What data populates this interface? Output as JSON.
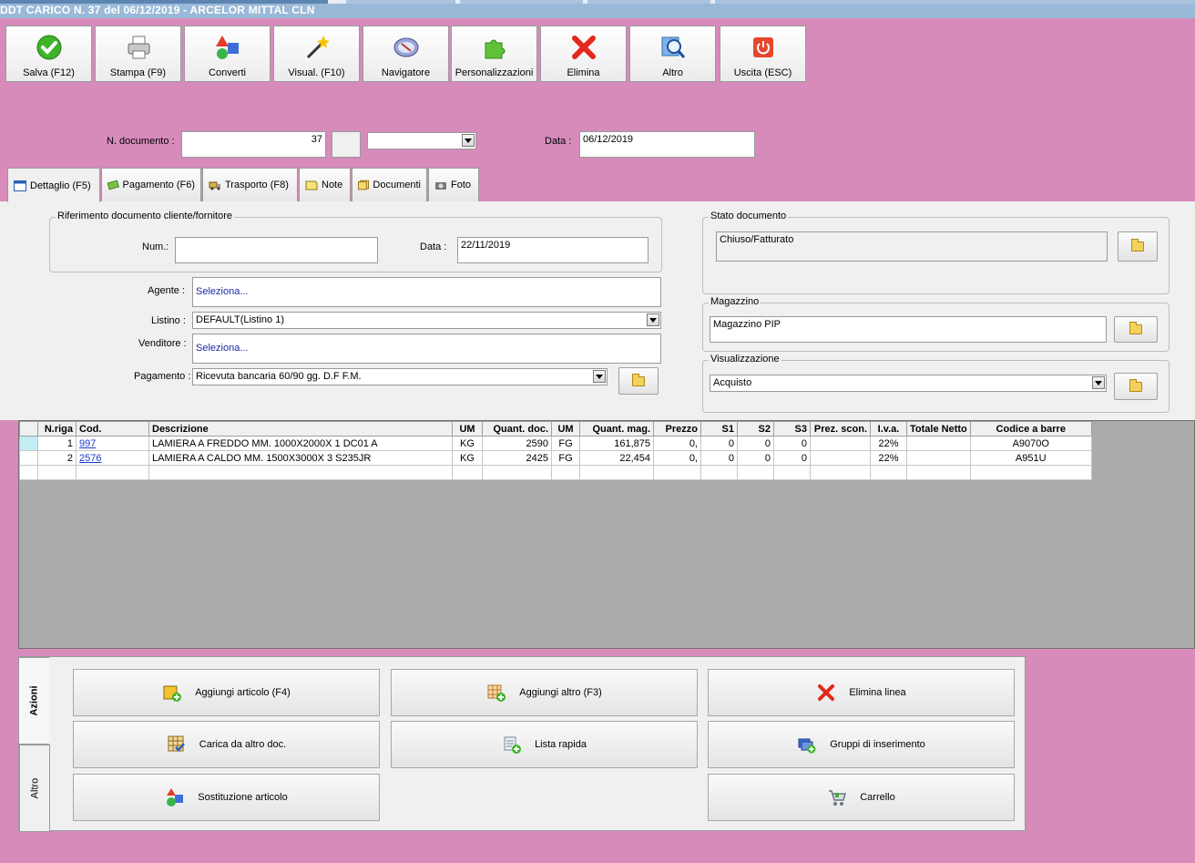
{
  "window": {
    "title": "DDT CARICO N. 37 del 06/12/2019 - ARCELOR MITTAL CLN"
  },
  "toolbar": [
    {
      "key": "salva",
      "label": "Salva (F12)",
      "icon": "checkmark-icon"
    },
    {
      "key": "stampa",
      "label": "Stampa (F9)",
      "icon": "printer-icon"
    },
    {
      "key": "converti",
      "label": "Converti",
      "icon": "convert-shapes-icon"
    },
    {
      "key": "visual",
      "label": "Visual. (F10)",
      "icon": "magic-wand-icon"
    },
    {
      "key": "navigatore",
      "label": "Navigatore",
      "icon": "compass-icon"
    },
    {
      "key": "personalizzazioni",
      "label": "Personalizzazioni",
      "icon": "puzzle-icon"
    },
    {
      "key": "elimina",
      "label": "Elimina",
      "icon": "red-x-icon"
    },
    {
      "key": "altro",
      "label": "Altro",
      "icon": "magnifier-icon"
    },
    {
      "key": "uscita",
      "label": "Uscita (ESC)",
      "icon": "power-icon"
    }
  ],
  "header": {
    "ndoc_label": "N. documento :",
    "ndoc_value": "37",
    "series_value": "",
    "data_label": "Data :",
    "data_value": "06/12/2019"
  },
  "tabs": [
    {
      "label": "Dettaglio (F5)",
      "icon": "calendar-icon",
      "active": true
    },
    {
      "label": "Pagamento (F6)",
      "icon": "money-icon"
    },
    {
      "label": "Trasporto (F8)",
      "icon": "truck-icon"
    },
    {
      "label": "Note",
      "icon": "note-icon"
    },
    {
      "label": "Documenti",
      "icon": "documents-icon"
    },
    {
      "label": "Foto",
      "icon": "camera-icon"
    }
  ],
  "riferimento": {
    "title": "Riferimento documento cliente/fornitore",
    "num_label": "Num.:",
    "num_value": "",
    "data_label": "Data :",
    "data_value": "22/11/2019"
  },
  "agente": {
    "label": "Agente :",
    "value": "Seleziona..."
  },
  "listino": {
    "label": "Listino :",
    "value": "DEFAULT(Listino 1)"
  },
  "venditore": {
    "label": "Venditore :",
    "value": "Seleziona..."
  },
  "pagamento": {
    "label": "Pagamento :",
    "value": "Ricevuta bancaria 60/90 gg. D.F F.M."
  },
  "stato": {
    "title": "Stato documento",
    "value": "Chiuso/Fatturato"
  },
  "magazzino": {
    "title": "Magazzino",
    "value": "Magazzino PIP"
  },
  "visualizzazione": {
    "title": "Visualizzazione",
    "value": "Acquisto"
  },
  "grid": {
    "columns": [
      "N.riga",
      "Cod.",
      "Descrizione",
      "UM",
      "Quant. doc.",
      "UM",
      "Quant. mag.",
      "Prezzo",
      "S1",
      "S2",
      "S3",
      "Prez. scon.",
      "I.v.a.",
      "Totale Netto",
      "Codice a barre"
    ],
    "rows": [
      [
        "1",
        "997",
        "LAMIERA A FREDDO MM. 1000X2000X 1  DC01 A",
        "KG",
        "2590",
        "FG",
        "161,875",
        "0,",
        "0",
        "0",
        "0",
        "",
        "22%",
        "",
        "A9070O"
      ],
      [
        "2",
        "2576",
        "LAMIERA A CALDO MM. 1500X3000X 3 S235JR",
        "KG",
        "2425",
        "FG",
        "22,454",
        "0,",
        "0",
        "0",
        "0",
        "",
        "22%",
        "",
        "A951U"
      ]
    ]
  },
  "actions": {
    "side_tabs": [
      "Azioni",
      "Altro"
    ],
    "buttons": [
      {
        "label": "Aggiungi articolo (F4)",
        "icon": "add-article-icon"
      },
      {
        "label": "Aggiungi altro (F3)",
        "icon": "add-grid-icon"
      },
      {
        "label": "Elimina linea",
        "icon": "red-x-icon"
      },
      {
        "label": "Carica da altro doc.",
        "icon": "load-doc-icon"
      },
      {
        "label": "Lista rapida",
        "icon": "quick-list-icon"
      },
      {
        "label": "Gruppi di inserimento",
        "icon": "group-insert-icon"
      },
      {
        "label": "Sostituzione articolo",
        "icon": "replace-article-icon"
      },
      {
        "label": "Carrello",
        "icon": "cart-icon"
      }
    ]
  }
}
